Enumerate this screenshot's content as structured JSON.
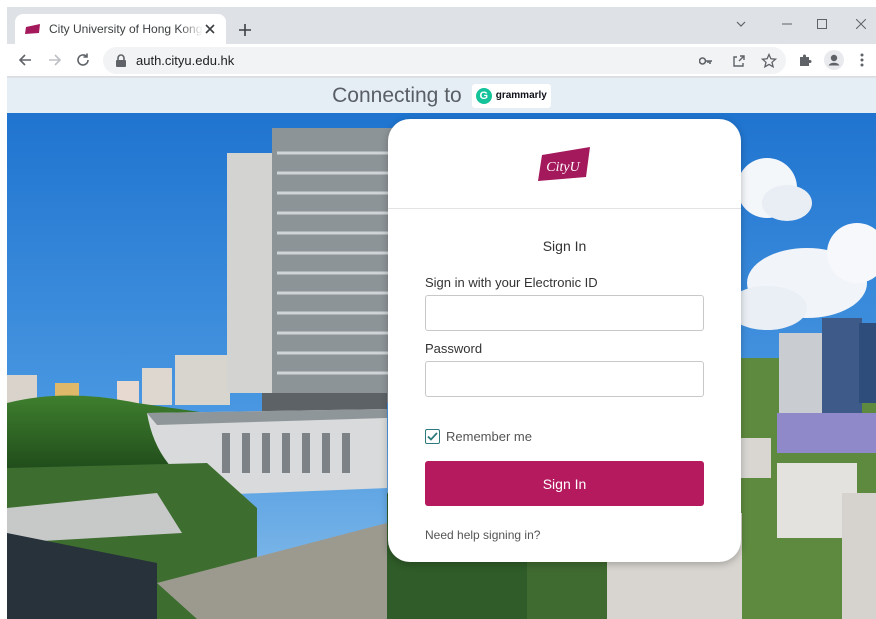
{
  "browser": {
    "tab_title": "City University of Hong Kong - Sign In",
    "url": "auth.cityu.edu.hk"
  },
  "banner": {
    "connecting_text": "Connecting to",
    "app_name": "grammarly",
    "app_color": "#15c39a"
  },
  "login": {
    "logo_text": "CityU",
    "title": "Sign In",
    "username_label": "Sign in with your Electronic ID",
    "username_value": "",
    "password_label": "Password",
    "password_value": "",
    "remember_label": "Remember me",
    "remember_checked": true,
    "submit_label": "Sign In",
    "help_link": "Need help signing in?",
    "brand_color": "#b5195e"
  }
}
